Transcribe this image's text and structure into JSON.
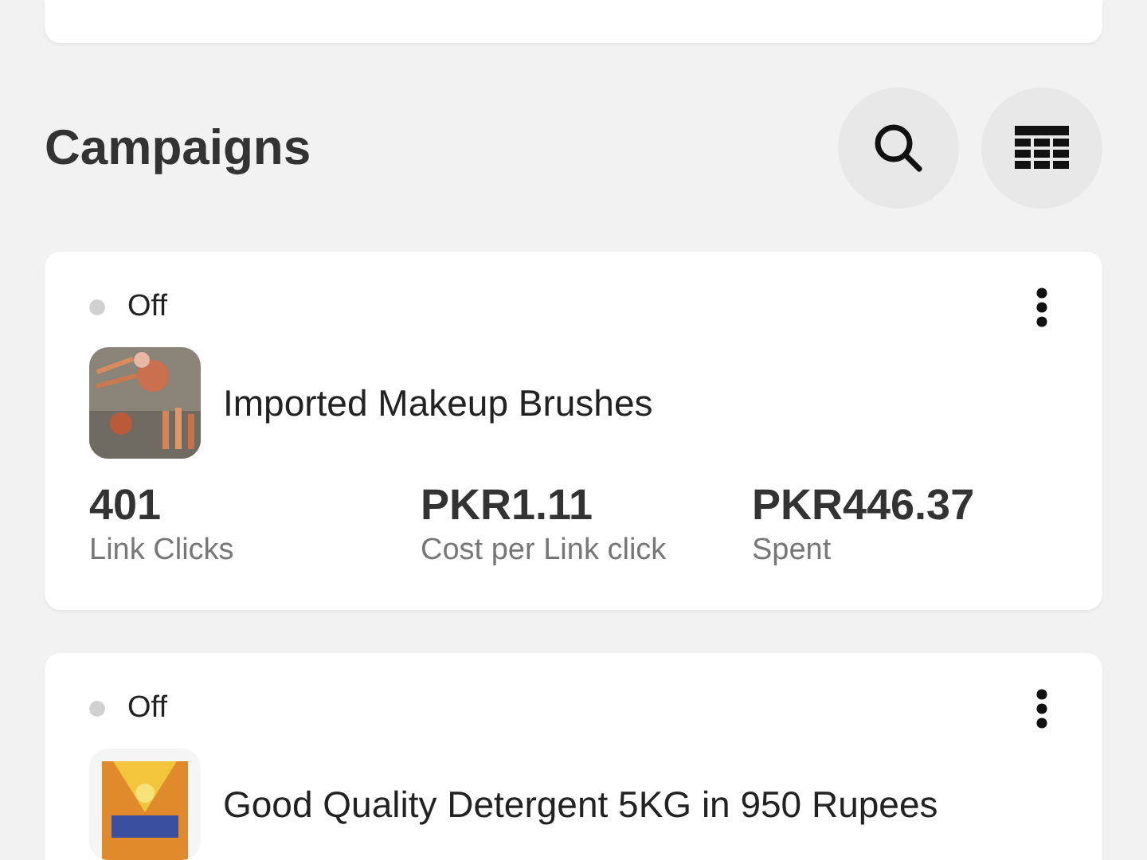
{
  "section_title": "Campaigns",
  "campaigns": [
    {
      "on": false,
      "status": "Off",
      "name": "Imported Makeup Brushes",
      "metrics": [
        {
          "value": "401",
          "label": "Link Clicks"
        },
        {
          "value": "PKR1.11",
          "label": "Cost per Link click"
        },
        {
          "value": "PKR446.37",
          "label": "Spent"
        }
      ]
    },
    {
      "on": false,
      "status": "Off",
      "name": "Good Quality Detergent 5KG in 950 Rupees"
    }
  ]
}
